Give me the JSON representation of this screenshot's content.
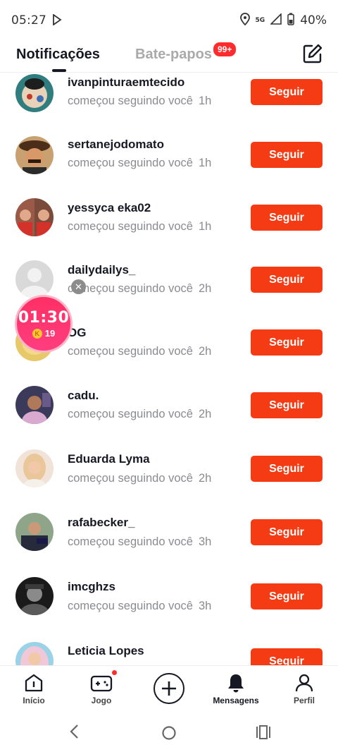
{
  "status": {
    "time": "05:27",
    "network": "5G",
    "battery": "40%"
  },
  "tabs": {
    "notifications": "Notificações",
    "chats": "Bate-papos",
    "chats_badge": "99+"
  },
  "notifications": [
    {
      "username": "ivanpinturaemtecido",
      "text": "começou seguindo você",
      "time": "1h",
      "button": "Seguir"
    },
    {
      "username": "sertanejodomato",
      "text": "começou seguindo você",
      "time": "1h",
      "button": "Seguir"
    },
    {
      "username": "yessyca eka02",
      "text": "começou seguindo você",
      "time": "1h",
      "button": "Seguir"
    },
    {
      "username": "dailydailys_",
      "text": "começou seguindo você",
      "time": "2h",
      "button": "Seguir"
    },
    {
      "username": "OG",
      "text": "começou seguindo você",
      "time": "2h",
      "button": "Seguir"
    },
    {
      "username": "cadu.",
      "text": "começou seguindo você",
      "time": "2h",
      "button": "Seguir"
    },
    {
      "username": "Eduarda Lyma",
      "text": "começou seguindo você",
      "time": "2h",
      "button": "Seguir"
    },
    {
      "username": "rafabecker_",
      "text": "começou seguindo você",
      "time": "3h",
      "button": "Seguir"
    },
    {
      "username": "imcghzs",
      "text": "começou seguindo você",
      "time": "3h",
      "button": "Seguir"
    },
    {
      "username": "Leticia Lopes",
      "text": "",
      "time": "",
      "button": "Seguir"
    }
  ],
  "timer": {
    "time": "01:30",
    "coins": "19"
  },
  "bottom_nav": {
    "home": "Início",
    "game": "Jogo",
    "messages": "Mensagens",
    "profile": "Perfil"
  },
  "colors": {
    "follow_button": "#f53b14",
    "badge": "#fe2c2c",
    "timer": "#ff2f64"
  }
}
